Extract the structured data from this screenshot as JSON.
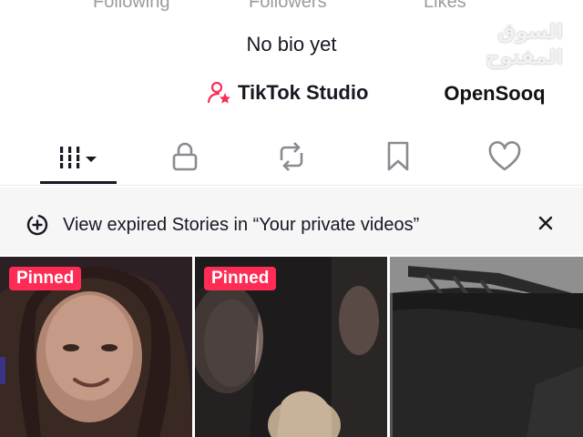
{
  "profile": {
    "stats": {
      "following_label": "Following",
      "followers_label": "Followers",
      "likes_label": "Likes"
    },
    "bio": "No bio yet",
    "studio_label": "TikTok Studio"
  },
  "watermark": {
    "arabic": "السوق المفتوح",
    "brand": "OpenSooq"
  },
  "tabs": [
    {
      "icon": "videos-grid-icon",
      "active": true
    },
    {
      "icon": "lock-icon",
      "active": false
    },
    {
      "icon": "repost-icon",
      "active": false
    },
    {
      "icon": "bookmark-icon",
      "active": false
    },
    {
      "icon": "heart-icon",
      "active": false
    }
  ],
  "notice": {
    "text": "View expired Stories in “Your private videos”",
    "icon": "story-plus-icon",
    "close_icon": "close-icon"
  },
  "videos": [
    {
      "pinned_label": "Pinned"
    },
    {
      "pinned_label": "Pinned"
    },
    {
      "pinned_label": ""
    }
  ],
  "colors": {
    "accent": "#fe2c55",
    "text_primary": "#161823",
    "text_muted": "#9a9ba1",
    "notice_bg": "#f6f6f7"
  }
}
